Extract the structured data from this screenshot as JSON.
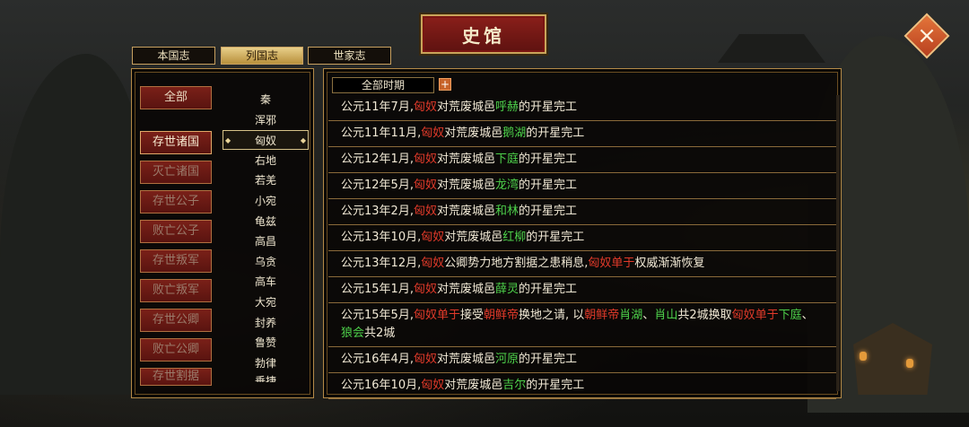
{
  "window": {
    "title": "史馆"
  },
  "tabs": [
    {
      "label": "本国志",
      "active": false
    },
    {
      "label": "列国志",
      "active": true
    },
    {
      "label": "世家志",
      "active": false
    }
  ],
  "categories": [
    {
      "label": "全部",
      "active": false
    },
    {
      "label": "存世诸国",
      "active": true
    },
    {
      "label": "灭亡诸国",
      "active": false
    },
    {
      "label": "存世公子",
      "active": false
    },
    {
      "label": "败亡公子",
      "active": false
    },
    {
      "label": "存世叛军",
      "active": false
    },
    {
      "label": "败亡叛军",
      "active": false
    },
    {
      "label": "存世公卿",
      "active": false
    },
    {
      "label": "败亡公卿",
      "active": false
    },
    {
      "label": "存世割据",
      "active": false
    }
  ],
  "nations": [
    "秦",
    "浑邪",
    "匈奴",
    "右地",
    "若羌",
    "小宛",
    "龟兹",
    "高昌",
    "乌贪",
    "高车",
    "大宛",
    "封养",
    "鲁赞",
    "勃律",
    "垂捷"
  ],
  "selected_nation": "匈奴",
  "period_filter": {
    "label": "全部时期",
    "toggle": "+"
  },
  "events": [
    [
      {
        "t": "公元11年7月,"
      },
      {
        "t": "匈奴",
        "c": "red"
      },
      {
        "t": "对荒废城邑"
      },
      {
        "t": "呼赫",
        "c": "green"
      },
      {
        "t": "的开星完工"
      }
    ],
    [
      {
        "t": "公元11年11月,"
      },
      {
        "t": "匈奴",
        "c": "red"
      },
      {
        "t": "对荒废城邑"
      },
      {
        "t": "鹅湖",
        "c": "green"
      },
      {
        "t": "的开星完工"
      }
    ],
    [
      {
        "t": "公元12年1月,"
      },
      {
        "t": "匈奴",
        "c": "red"
      },
      {
        "t": "对荒废城邑"
      },
      {
        "t": "下庭",
        "c": "green"
      },
      {
        "t": "的开星完工"
      }
    ],
    [
      {
        "t": "公元12年5月,"
      },
      {
        "t": "匈奴",
        "c": "red"
      },
      {
        "t": "对荒废城邑"
      },
      {
        "t": "龙湾",
        "c": "green"
      },
      {
        "t": "的开星完工"
      }
    ],
    [
      {
        "t": "公元13年2月,"
      },
      {
        "t": "匈奴",
        "c": "red"
      },
      {
        "t": "对荒废城邑"
      },
      {
        "t": "和林",
        "c": "green"
      },
      {
        "t": "的开星完工"
      }
    ],
    [
      {
        "t": "公元13年10月,"
      },
      {
        "t": "匈奴",
        "c": "red"
      },
      {
        "t": "对荒废城邑"
      },
      {
        "t": "红柳",
        "c": "green"
      },
      {
        "t": "的开星完工"
      }
    ],
    [
      {
        "t": "公元13年12月,"
      },
      {
        "t": "匈奴",
        "c": "red"
      },
      {
        "t": "公卿势力地方割据之患稍息,"
      },
      {
        "t": "匈奴单于",
        "c": "red"
      },
      {
        "t": "权威渐渐恢复"
      }
    ],
    [
      {
        "t": "公元15年1月,"
      },
      {
        "t": "匈奴",
        "c": "red"
      },
      {
        "t": "对荒废城邑"
      },
      {
        "t": "薛灵",
        "c": "green"
      },
      {
        "t": "的开星完工"
      }
    ],
    [
      {
        "t": "公元15年5月,"
      },
      {
        "t": "匈奴单于",
        "c": "red"
      },
      {
        "t": "接受"
      },
      {
        "t": "朝鲜帝",
        "c": "red"
      },
      {
        "t": "换地之请, 以"
      },
      {
        "t": "朝鲜帝",
        "c": "red"
      },
      {
        "t": "肖湖",
        "c": "green"
      },
      {
        "t": "、"
      },
      {
        "t": "肖山",
        "c": "green"
      },
      {
        "t": "共2城换取"
      },
      {
        "t": "匈奴单于",
        "c": "red"
      },
      {
        "t": "下庭",
        "c": "green"
      },
      {
        "t": "、"
      },
      {
        "t": "狼会",
        "c": "green"
      },
      {
        "t": "共2城"
      }
    ],
    [
      {
        "t": "公元16年4月,"
      },
      {
        "t": "匈奴",
        "c": "red"
      },
      {
        "t": "对荒废城邑"
      },
      {
        "t": "河原",
        "c": "green"
      },
      {
        "t": "的开星完工"
      }
    ],
    [
      {
        "t": "公元16年10月,"
      },
      {
        "t": "匈奴",
        "c": "red"
      },
      {
        "t": "对荒废城邑"
      },
      {
        "t": "吉尔",
        "c": "green"
      },
      {
        "t": "的开星完工"
      }
    ]
  ],
  "colors": {
    "highlight_red": "#e23a2a",
    "highlight_green": "#4dd04a",
    "accent_gold": "#c9a45a"
  },
  "icons": {
    "close": "close-icon"
  }
}
